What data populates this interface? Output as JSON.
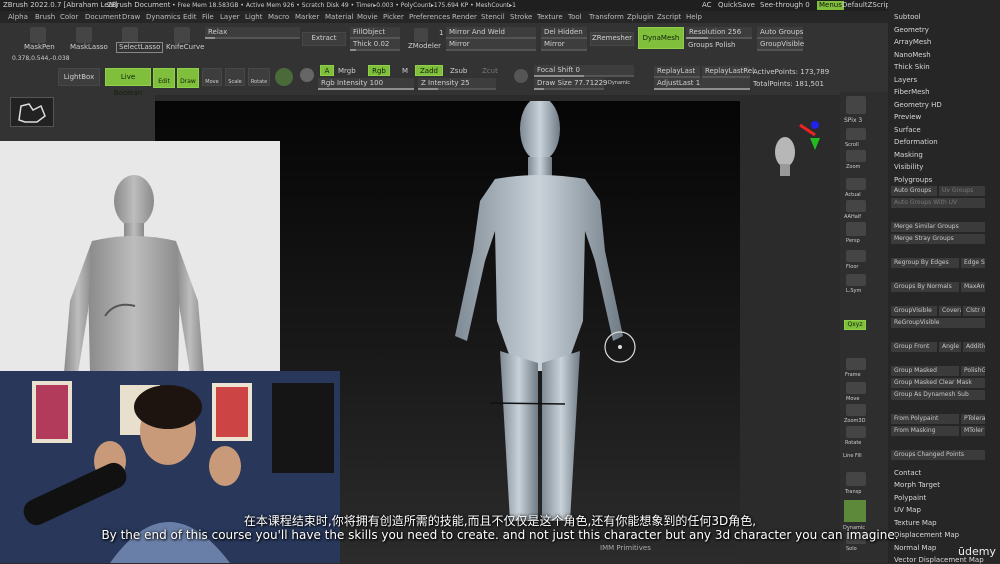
{
  "titlebar": {
    "app": "ZBrush 2022.0.7 [Abraham Leal]",
    "doc": "ZBrush Document",
    "stats": "• Free Mem 18.583GB • Active Mem 926 • Scratch Disk 49 • Timer▸0.003 • PolyCount▸175.694 KP • MeshCount▸1",
    "ac": "AC",
    "quicksave": "QuickSave",
    "see_through": "See-through  0",
    "menus": "Menus",
    "script": "DefaultZScript"
  },
  "menu": [
    "Alpha",
    "Brush",
    "Color",
    "Document",
    "Draw",
    "Dynamics",
    "Edit",
    "File",
    "Layer",
    "Light",
    "Macro",
    "Marker",
    "Material",
    "Movie",
    "Picker",
    "Preferences",
    "Render",
    "Stencil",
    "Stroke",
    "Texture",
    "Tool",
    "Transform",
    "Zplugin",
    "Zscript",
    "Help"
  ],
  "shelf": {
    "mask_pen": "MaskPen",
    "mask_lasso": "MaskLasso",
    "select_lasso": "SelectLasso",
    "knife_curve": "KnifeCurve",
    "relax": "Relax",
    "extract": "Extract",
    "fill_object": "FillObject",
    "thick": "Thick 0.02",
    "zmodeler": "ZModeler",
    "one": "1",
    "mirror_weld": "Mirror And Weld",
    "mirror": "Mirror",
    "del_hidden": "Del Hidden",
    "mirror2": "Mirror",
    "zremesher": "ZRemesher",
    "dynamesh": "DynaMesh",
    "resolution": "Resolution 256",
    "groups_polish": "Groups  Polish",
    "auto_groups": "Auto Groups",
    "group_visible": "GroupVisible",
    "coords": "0.378,0.544,-0.038",
    "lightbox": "LightBox",
    "live_boolean": "Live Boolean",
    "edit": "Edit",
    "draw": "Draw",
    "move": "Move",
    "scale": "Scale",
    "rotate": "Rotate",
    "a": "A",
    "mrgb": "Mrgb",
    "rgb": "Rgb",
    "m": "M",
    "zadd": "Zadd",
    "zsub": "Zsub",
    "zcut": "Zcut",
    "rgb_intensity": "Rgb Intensity 100",
    "z_intensity": "Z Intensity 25",
    "focal_shift": "Focal Shift 0",
    "draw_size": "Draw Size 77.71229",
    "dynamic": "Dynamic",
    "replay_last": "ReplayLast",
    "replay_last_rel": "ReplayLastRel",
    "adjust_last": "AdjustLast 1",
    "active_points": "ActivePoints: 173,789",
    "total_points": "TotalPoints: 181,501"
  },
  "right_shelf": [
    "SPix 3",
    "Scroll",
    "Zoom",
    "Actual",
    "AAHalf",
    "Persp",
    "Floor",
    "L.Sym",
    "Qxyz",
    "Frame",
    "Move",
    "Zoom3D",
    "Rotate",
    "Line Fill",
    "Transp",
    "Dynamic",
    "Solo"
  ],
  "right_panel": {
    "top_items": [
      "Subtool",
      "Geometry",
      "ArrayMesh",
      "NanoMesh",
      "Thick Skin",
      "Layers",
      "FiberMesh",
      "Geometry HD",
      "Preview",
      "Surface",
      "Deformation",
      "Masking",
      "Visibility",
      "Polygroups"
    ],
    "buttons": [
      "Auto Groups",
      "Uv Groups",
      "Auto Groups With UV",
      "Merge Similar Groups",
      "Merge Stray Groups",
      "Regroup By Edges",
      "Edge S",
      "Groups By Normals",
      "MaxAn",
      "GroupVisible",
      "Covera",
      "Clstr 0",
      "ReGroupVisible",
      "Group Front",
      "Angle",
      "Additive",
      "Group Masked",
      "PolishG",
      "Group Masked Clear Mask",
      "Group As Dynamesh Sub",
      "From Polypaint",
      "PTolera",
      "From Masking",
      "MToler",
      "Groups Changed Points"
    ],
    "bottom_items": [
      "Contact",
      "Morph Target",
      "Polypaint",
      "UV Map",
      "Texture Map",
      "Displacement Map",
      "Normal Map",
      "Vector Displacement Map"
    ]
  },
  "viewport_label": "IMM Primitives",
  "subtitles": {
    "zh": "在本课程结束时,你将拥有创造所需的技能,而且不仅仅是这个角色,还有你能想象到的任何3D角色,",
    "en": "By the end of this course you'll have the skills you need to create. and not just this character but any 3d character you can imagine."
  },
  "watermark": "ūdemy",
  "colors": {
    "accent": "#7fbf3c",
    "panel": "#262626",
    "viewport": "#0d0d0d"
  }
}
